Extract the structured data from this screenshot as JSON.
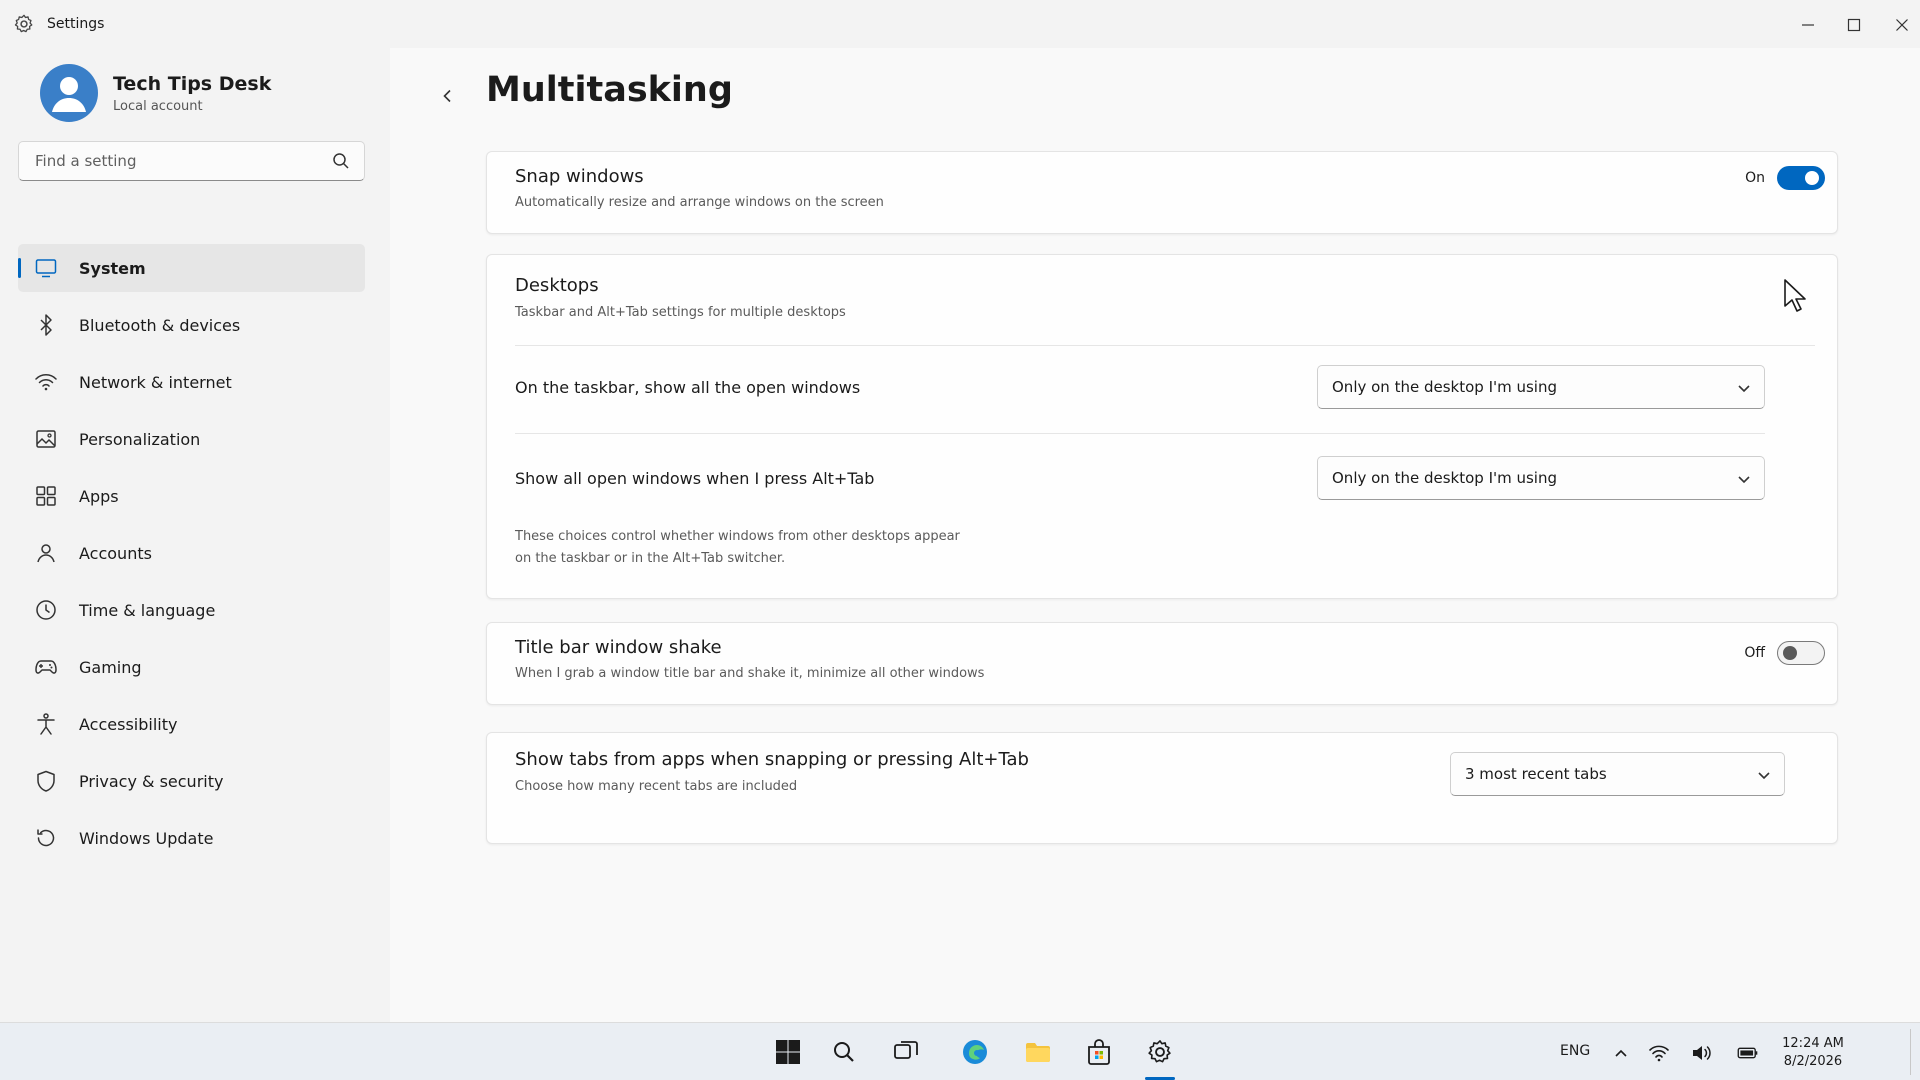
{
  "window": {
    "title": "Settings"
  },
  "profile": {
    "name": "Tech Tips Desk",
    "account_type": "Local account"
  },
  "search": {
    "placeholder": "Find a setting"
  },
  "sidebar": {
    "items": [
      {
        "label": "System",
        "icon": "monitor-icon",
        "active": true
      },
      {
        "label": "Bluetooth & devices",
        "icon": "bluetooth-icon"
      },
      {
        "label": "Network & internet",
        "icon": "wifi-icon"
      },
      {
        "label": "Personalization",
        "icon": "image-icon"
      },
      {
        "label": "Apps",
        "icon": "apps-grid-icon"
      },
      {
        "label": "Accounts",
        "icon": "person-icon"
      },
      {
        "label": "Time & language",
        "icon": "clock-icon"
      },
      {
        "label": "Gaming",
        "icon": "gamepad-icon"
      },
      {
        "label": "Accessibility",
        "icon": "accessibility-icon"
      },
      {
        "label": "Privacy & security",
        "icon": "shield-icon"
      },
      {
        "label": "Windows Update",
        "icon": "update-icon"
      }
    ]
  },
  "page": {
    "title": "Multitasking"
  },
  "snap": {
    "title": "Snap windows",
    "subtitle": "Automatically resize and arrange windows on the screen",
    "state_label": "On",
    "enabled": true
  },
  "desktops": {
    "title": "Desktops",
    "subtitle": "Taskbar and Alt+Tab settings for multiple desktops",
    "taskbar_label": "On the taskbar, show all the open windows",
    "taskbar_value": "Only on the desktop I'm using",
    "alttab_label": "Show all open windows when I press Alt+Tab",
    "alttab_value": "Only on the desktop I'm using",
    "note_line1": "These choices control whether windows from other desktops appear",
    "note_line2": "on the taskbar or in the Alt+Tab switcher."
  },
  "shake": {
    "title": "Title bar window shake",
    "subtitle": "When I grab a window title bar and shake it, minimize all other windows",
    "state_label": "Off",
    "enabled": false
  },
  "tabs": {
    "title": "Show tabs from apps when snapping or pressing Alt+Tab",
    "subtitle": "Choose how many recent tabs are included",
    "value": "3 most recent tabs"
  },
  "taskbar": {
    "language": "ENG",
    "time": "12:24 AM",
    "date": "8/2/2026"
  },
  "colors": {
    "accent": "#0067c0"
  }
}
